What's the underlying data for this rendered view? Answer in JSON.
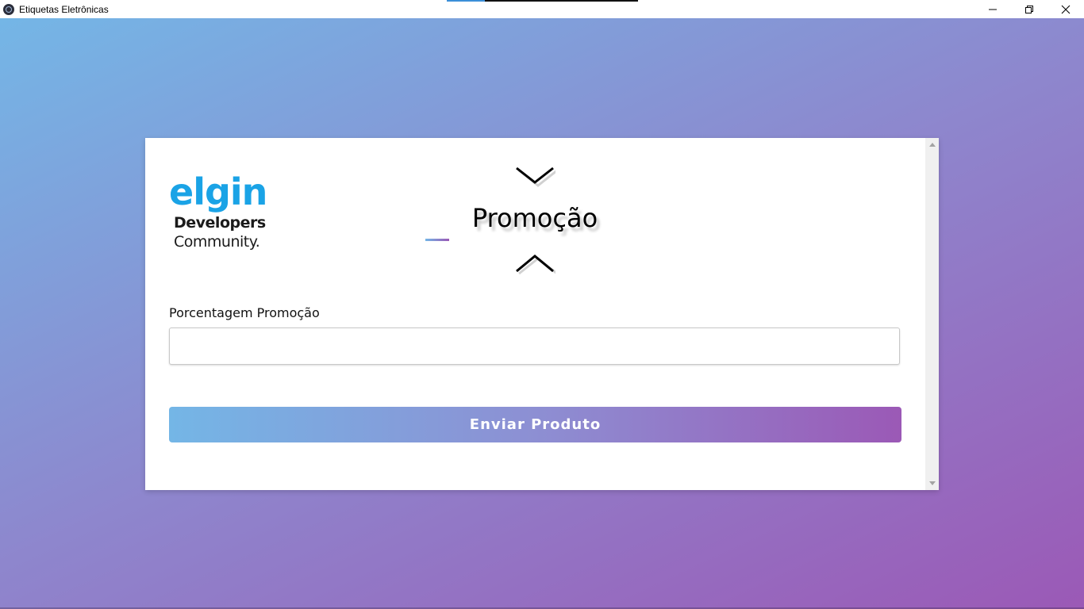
{
  "window": {
    "title": "Etiquetas Eletrônicas",
    "progress_fraction": 0.2
  },
  "logo": {
    "brand": "elgin",
    "line1": "Developers",
    "line2": "Community."
  },
  "mode": {
    "title": "Promoção"
  },
  "form": {
    "label": "Porcentagem Promoção",
    "value": "",
    "placeholder": "",
    "submit_label": "Enviar Produto"
  },
  "colors": {
    "gradient_start": "#74b6e6",
    "gradient_end": "#9b59b6",
    "brand_blue": "#1aa3e6"
  },
  "icons": {
    "app": "electron-icon",
    "minimize": "minimize-icon",
    "restore": "restore-icon",
    "close": "close-icon",
    "next": "chevron-down-icon",
    "previous": "chevron-up-icon"
  }
}
